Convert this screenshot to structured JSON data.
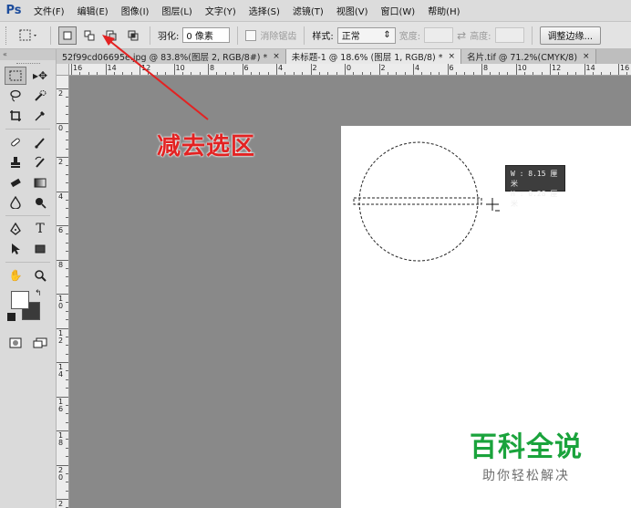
{
  "app": {
    "logo": "Ps"
  },
  "menu": [
    "文件(F)",
    "编辑(E)",
    "图像(I)",
    "图层(L)",
    "文字(Y)",
    "选择(S)",
    "滤镜(T)",
    "视图(V)",
    "窗口(W)",
    "帮助(H)"
  ],
  "options": {
    "feather_label": "羽化:",
    "feather_value": "0 像素",
    "antialias_label": "消除锯齿",
    "style_label": "样式:",
    "style_value": "正常",
    "width_label": "宽度:",
    "height_label": "高度:",
    "refine_label": "调整边缘..."
  },
  "tabs": [
    {
      "label": "52f99cd06695e.jpg @ 83.8%(图层 2, RGB/8#) *",
      "close": "×"
    },
    {
      "label": "未标题-1 @ 18.6% (图层 1, RGB/8) *",
      "close": "×"
    },
    {
      "label": "名片.tif @ 71.2%(CMYK/8)",
      "close": "×"
    }
  ],
  "ruler": {
    "h_labels": [
      "16",
      "14",
      "12",
      "10",
      "8",
      "6",
      "4",
      "2",
      "0",
      "2",
      "4",
      "6",
      "8",
      "10",
      "12",
      "14",
      "16"
    ],
    "v_labels": [
      "2",
      "0",
      "2",
      "4",
      "6",
      "8",
      "10",
      "12",
      "14",
      "16",
      "18",
      "20",
      "22"
    ]
  },
  "tooltip": {
    "w_line": "W : 8.15 厘米",
    "h_line": "H : 0.28 厘米"
  },
  "annotation": {
    "text": "减去选区"
  },
  "watermark": {
    "main": "百科全说",
    "sub": "助你轻松解决"
  },
  "colors": {
    "foreground": "#ffffff",
    "background": "#3a3a3a",
    "annotation": "#e32222",
    "watermark": "#1aa33c"
  }
}
